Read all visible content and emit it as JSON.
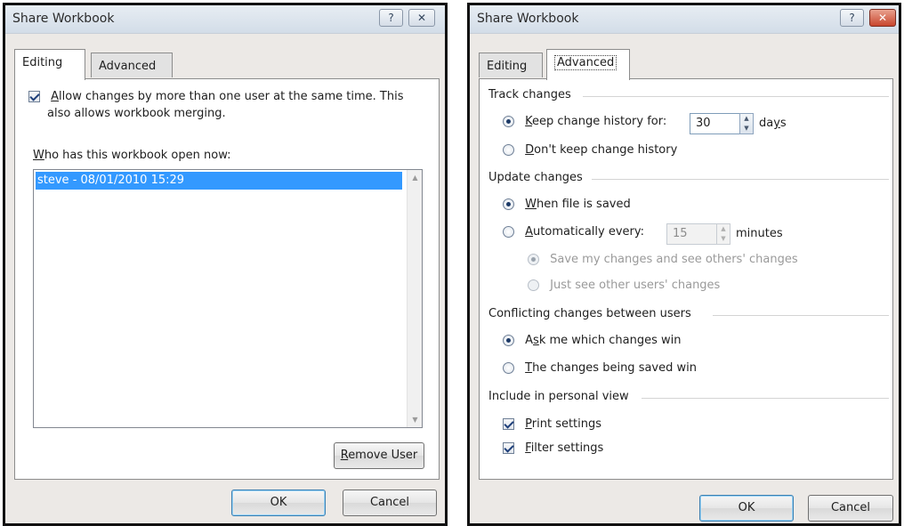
{
  "left_dialog": {
    "title": "Share Workbook",
    "help_button": "?",
    "close_button": "✕",
    "tabs": [
      {
        "label": "Editing"
      },
      {
        "label": "Advanced"
      }
    ],
    "allow_changes": {
      "checked": true,
      "line1_pre": "",
      "line1_key": "A",
      "line1_post": "llow changes by more than one user at the same time.  This",
      "line2": "also allows workbook merging."
    },
    "who_label_key": "W",
    "who_label_post": "ho has this workbook open now:",
    "users": [
      "steve - 08/01/2010 15:29"
    ],
    "remove_button_key": "R",
    "remove_button_post": "emove User",
    "ok_button": "OK",
    "cancel_button": "Cancel"
  },
  "right_dialog": {
    "title": "Share Workbook",
    "help_button": "?",
    "close_button": "✕",
    "tabs": [
      {
        "label": "Editing"
      },
      {
        "label": "Advanced"
      }
    ],
    "track_changes": {
      "heading": "Track changes",
      "keep_key": "K",
      "keep_post": "eep change history for:",
      "keep_value": "30",
      "days_pre": "da",
      "days_key": "y",
      "days_post": "s",
      "dont_key": "D",
      "dont_post": "on't keep change history",
      "selected": "keep"
    },
    "update_changes": {
      "heading": "Update changes",
      "when_key": "W",
      "when_post": "hen file is saved",
      "auto_key": "A",
      "auto_post": "utomatically every:",
      "auto_value": "15",
      "minutes": "minutes",
      "save_see": "Save my changes and see others' changes",
      "just_see": "Just see other users' changes",
      "selected": "when_saved"
    },
    "conflicting": {
      "heading": "Conflicting changes between users",
      "ask_pre": "A",
      "ask_key": "s",
      "ask_post": "k me which changes win",
      "saved_key": "T",
      "saved_post": "he changes being saved win",
      "selected": "ask"
    },
    "personal_view": {
      "heading": "Include in personal view",
      "print_key": "P",
      "print_post": "rint settings",
      "filter_key": "F",
      "filter_post": "ilter settings",
      "print_checked": true,
      "filter_checked": true
    },
    "ok_button": "OK",
    "cancel_button": "Cancel"
  },
  "colors": {
    "selection": "#3399ff",
    "dialog_bg": "#ece9e6",
    "default_button_border": "#3c7fb1"
  }
}
